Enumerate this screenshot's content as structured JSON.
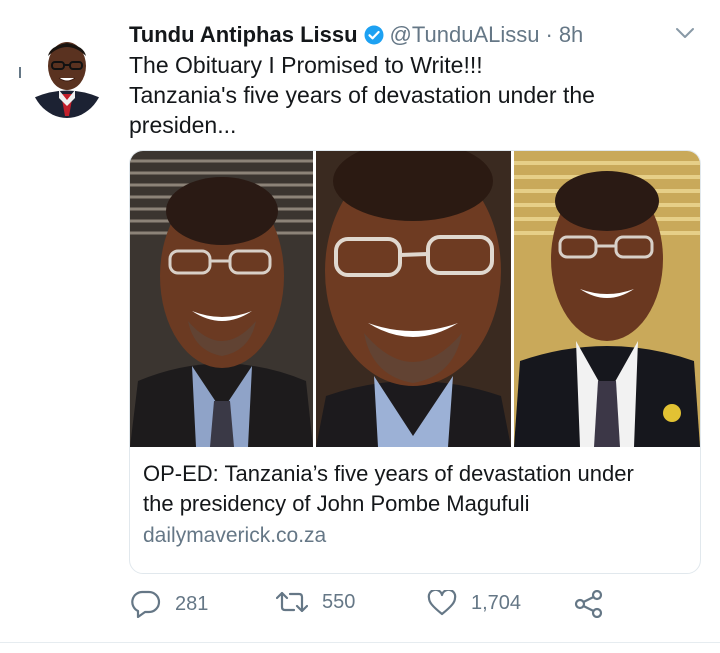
{
  "tweet": {
    "author_name": "Tundu Antiphas Lissu",
    "handle": "@TunduALissu",
    "separator": "·",
    "time": "8h",
    "text_lines": [
      "The Obituary I Promised to Write!!!",
      "Tanzania's five years of devastation under the",
      "presiden..."
    ]
  },
  "card": {
    "title_lines": [
      "OP-ED: Tanzania’s five years of devastation under",
      "the presidency of John Pombe Magufuli"
    ],
    "domain": "dailymaverick.co.za"
  },
  "actions": {
    "reply_count": "281",
    "retweet_count": "550",
    "like_count": "1,704"
  },
  "icons": {
    "verified": "verified-badge-icon",
    "caret": "chevron-down-icon",
    "reply": "reply-icon",
    "retweet": "retweet-icon",
    "like": "heart-icon",
    "share": "share-icon"
  },
  "colors": {
    "text": "#14171a",
    "muted": "#657786",
    "verified": "#1da1f2",
    "border": "#e1e8ed"
  }
}
